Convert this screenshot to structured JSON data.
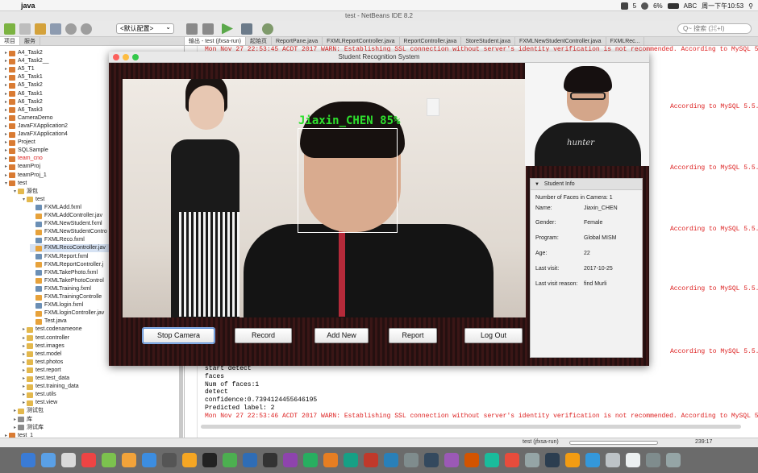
{
  "menubar": {
    "apple_icon": "",
    "app_name": "java",
    "right_items": [
      "5",
      "6%",
      "ABC",
      "周一下午10:53"
    ]
  },
  "ide": {
    "title": "test - NetBeans IDE 8.2",
    "config_select": "<默认配置>",
    "search_placeholder": "Q~ 搜索 (⌘+I)"
  },
  "project_panel": {
    "tabs": [
      "项目",
      "服务"
    ],
    "items": [
      {
        "label": "A4_Task2",
        "icon": "proj",
        "depth": 0
      },
      {
        "label": "A4_Task2__",
        "icon": "proj",
        "depth": 0
      },
      {
        "label": "A5_T1",
        "icon": "proj",
        "depth": 0
      },
      {
        "label": "A5_Task1",
        "icon": "proj",
        "depth": 0
      },
      {
        "label": "A5_Task2",
        "icon": "proj",
        "depth": 0
      },
      {
        "label": "A6_Task1",
        "icon": "proj",
        "depth": 0
      },
      {
        "label": "A6_Task2",
        "icon": "proj",
        "depth": 0
      },
      {
        "label": "A6_Task3",
        "icon": "proj",
        "depth": 0
      },
      {
        "label": "CameraDemo",
        "icon": "proj",
        "depth": 0
      },
      {
        "label": "JavaFXApplication2",
        "icon": "proj",
        "depth": 0
      },
      {
        "label": "JavaFXApplication4",
        "icon": "proj",
        "depth": 0
      },
      {
        "label": "Project",
        "icon": "proj",
        "depth": 0
      },
      {
        "label": "SQLSample",
        "icon": "proj",
        "depth": 0
      },
      {
        "label": "team_cno",
        "icon": "proj",
        "depth": 0,
        "red": true
      },
      {
        "label": "teamProj",
        "icon": "proj",
        "depth": 0
      },
      {
        "label": "teamProj_1",
        "icon": "proj",
        "depth": 0
      },
      {
        "label": "test",
        "icon": "proj",
        "depth": 0,
        "open": true
      },
      {
        "label": "源包",
        "icon": "pkg",
        "depth": 1,
        "open": true
      },
      {
        "label": "test",
        "icon": "pkg",
        "depth": 2,
        "open": true
      },
      {
        "label": "FXMLAdd.fxml",
        "icon": "fxml",
        "depth": 3
      },
      {
        "label": "FXMLAddController.jav",
        "icon": "java",
        "depth": 3
      },
      {
        "label": "FXMLNewStudent.fxml",
        "icon": "fxml",
        "depth": 3
      },
      {
        "label": "FXMLNewStudentContro",
        "icon": "java",
        "depth": 3
      },
      {
        "label": "FXMLReco.fxml",
        "icon": "fxml",
        "depth": 3
      },
      {
        "label": "FXMLRecoController.jav",
        "icon": "java",
        "depth": 3,
        "selected": true
      },
      {
        "label": "FXMLReport.fxml",
        "icon": "fxml",
        "depth": 3
      },
      {
        "label": "FXMLReportController.j",
        "icon": "java",
        "depth": 3
      },
      {
        "label": "FXMLTakePhoto.fxml",
        "icon": "fxml",
        "depth": 3
      },
      {
        "label": "FXMLTakePhotoControl",
        "icon": "java",
        "depth": 3
      },
      {
        "label": "FXMLTraining.fxml",
        "icon": "fxml",
        "depth": 3
      },
      {
        "label": "FXMLTrainingControlle",
        "icon": "java",
        "depth": 3
      },
      {
        "label": "FXMLlogin.fxml",
        "icon": "fxml",
        "depth": 3
      },
      {
        "label": "FXMLloginController.jav",
        "icon": "java",
        "depth": 3
      },
      {
        "label": "Test.java",
        "icon": "java",
        "depth": 3
      },
      {
        "label": "test.codenameone",
        "icon": "pkg",
        "depth": 2
      },
      {
        "label": "test.controller",
        "icon": "pkg",
        "depth": 2
      },
      {
        "label": "test.images",
        "icon": "pkg",
        "depth": 2
      },
      {
        "label": "test.model",
        "icon": "pkg",
        "depth": 2
      },
      {
        "label": "test.photos",
        "icon": "pkg",
        "depth": 2
      },
      {
        "label": "test.report",
        "icon": "pkg",
        "depth": 2
      },
      {
        "label": "test.test_data",
        "icon": "pkg",
        "depth": 2
      },
      {
        "label": "test.training_data",
        "icon": "pkg",
        "depth": 2
      },
      {
        "label": "test.utils",
        "icon": "pkg",
        "depth": 2
      },
      {
        "label": "test.view",
        "icon": "pkg",
        "depth": 2
      },
      {
        "label": "测试包",
        "icon": "pkg",
        "depth": 1
      },
      {
        "label": "库",
        "icon": "lib",
        "depth": 1
      },
      {
        "label": "测试库",
        "icon": "lib",
        "depth": 1
      },
      {
        "label": "test_1",
        "icon": "proj",
        "depth": 0
      }
    ]
  },
  "editor": {
    "tabs": [
      "输出 - test (jfxsa-run)",
      "起始页",
      "ReportPane.java",
      "FXMLReportController.java",
      "ReportController.java",
      "StoreStudent.java",
      "FXMLNewStudentController.java",
      "FXMLRec..."
    ],
    "top_line": "Mon Nov 27 22:53:45 ACDT 2017 WARN: Establishing SSL connection without server's identity verification is not recommended. According to MySQL 5.5.45+,",
    "right_fragment": "According to MySQL 5.5.45+,",
    "bottom_lines": [
      {
        "text": "start detect",
        "warn": false
      },
      {
        "text": "faces",
        "warn": false
      },
      {
        "text": "Num of faces:1",
        "warn": false
      },
      {
        "text": "detect",
        "warn": false
      },
      {
        "text": "confidence:0.7394124455646195",
        "warn": false
      },
      {
        "text": "Predicted label: 2",
        "warn": false
      },
      {
        "text": "Mon Nov 27 22:53:46 ACDT 2017 WARN: Establishing SSL connection without server's identity verification is not recommended. According to MySQL 5.5.45+,",
        "warn": true
      }
    ]
  },
  "statusbar": {
    "run_label": "test (jfxsa-run)",
    "position": "239:17"
  },
  "app_window": {
    "title": "Student Recognition System",
    "face_label": "Jiaxin_CHEN 85%",
    "photo_shirt_text": "hunter",
    "info_panel": {
      "header": "Student Info",
      "faces_line": "Number of Faces in Camera: 1",
      "rows": [
        {
          "label": "Name:",
          "value": "Jiaxin_CHEN"
        },
        {
          "label": "Gender:",
          "value": "Female"
        },
        {
          "label": "Program:",
          "value": "Global MISM"
        },
        {
          "label": "Age:",
          "value": "22"
        },
        {
          "label": "Last visit:",
          "value": "2017-10-25"
        },
        {
          "label": "Last visit reason:",
          "value": "find Murli"
        }
      ]
    },
    "buttons": {
      "stop_camera": "Stop Camera",
      "record": "Record",
      "add_new": "Add New",
      "report": "Report",
      "log_out": "Log Out"
    }
  },
  "colors": {
    "console_warn": "#dd2222",
    "face_label": "#2ee02e",
    "dock_bg": "#6b6b6b"
  }
}
